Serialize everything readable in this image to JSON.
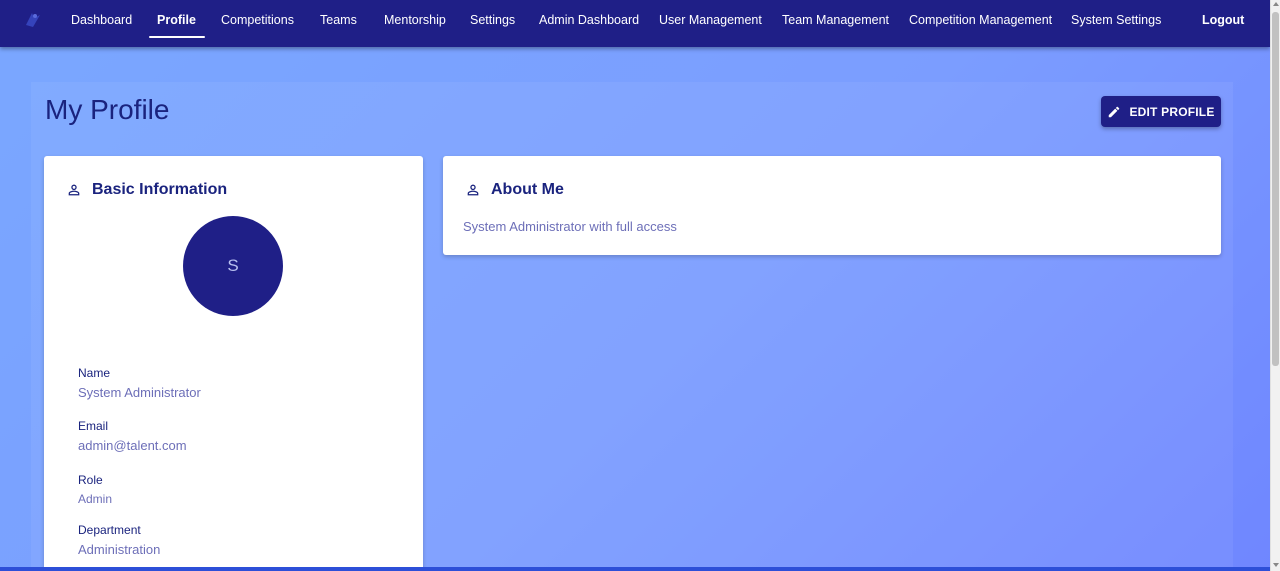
{
  "nav": {
    "items": [
      {
        "label": "Dashboard"
      },
      {
        "label": "Profile"
      },
      {
        "label": "Competitions"
      },
      {
        "label": "Teams"
      },
      {
        "label": "Mentorship"
      },
      {
        "label": "Settings"
      },
      {
        "label": "Admin Dashboard"
      },
      {
        "label": "User Management"
      },
      {
        "label": "Team Management"
      },
      {
        "label": "Competition Management"
      },
      {
        "label": "System Settings"
      }
    ],
    "active": "Profile",
    "logout_label": "Logout"
  },
  "page": {
    "title": "My Profile",
    "edit_button_label": "EDIT PROFILE"
  },
  "basic_info": {
    "title": "Basic Information",
    "avatar_initial": "S",
    "fields": [
      {
        "label": "Name",
        "value": "System Administrator"
      },
      {
        "label": "Email",
        "value": "admin@talent.com"
      },
      {
        "label": "Role",
        "value": "Admin"
      },
      {
        "label": "Department",
        "value": "Administration"
      }
    ]
  },
  "about": {
    "title": "About Me",
    "text": "System Administrator with full access"
  },
  "colors": {
    "navbar": "#1f1f87",
    "accent": "#1a237e",
    "secondary_text": "#6d6fb8",
    "background_start": "#7aa7ff",
    "background_end": "#6f86ff"
  },
  "icons": {
    "edit": "pencil-icon",
    "basic_info": "person-icon",
    "about": "person-icon"
  }
}
